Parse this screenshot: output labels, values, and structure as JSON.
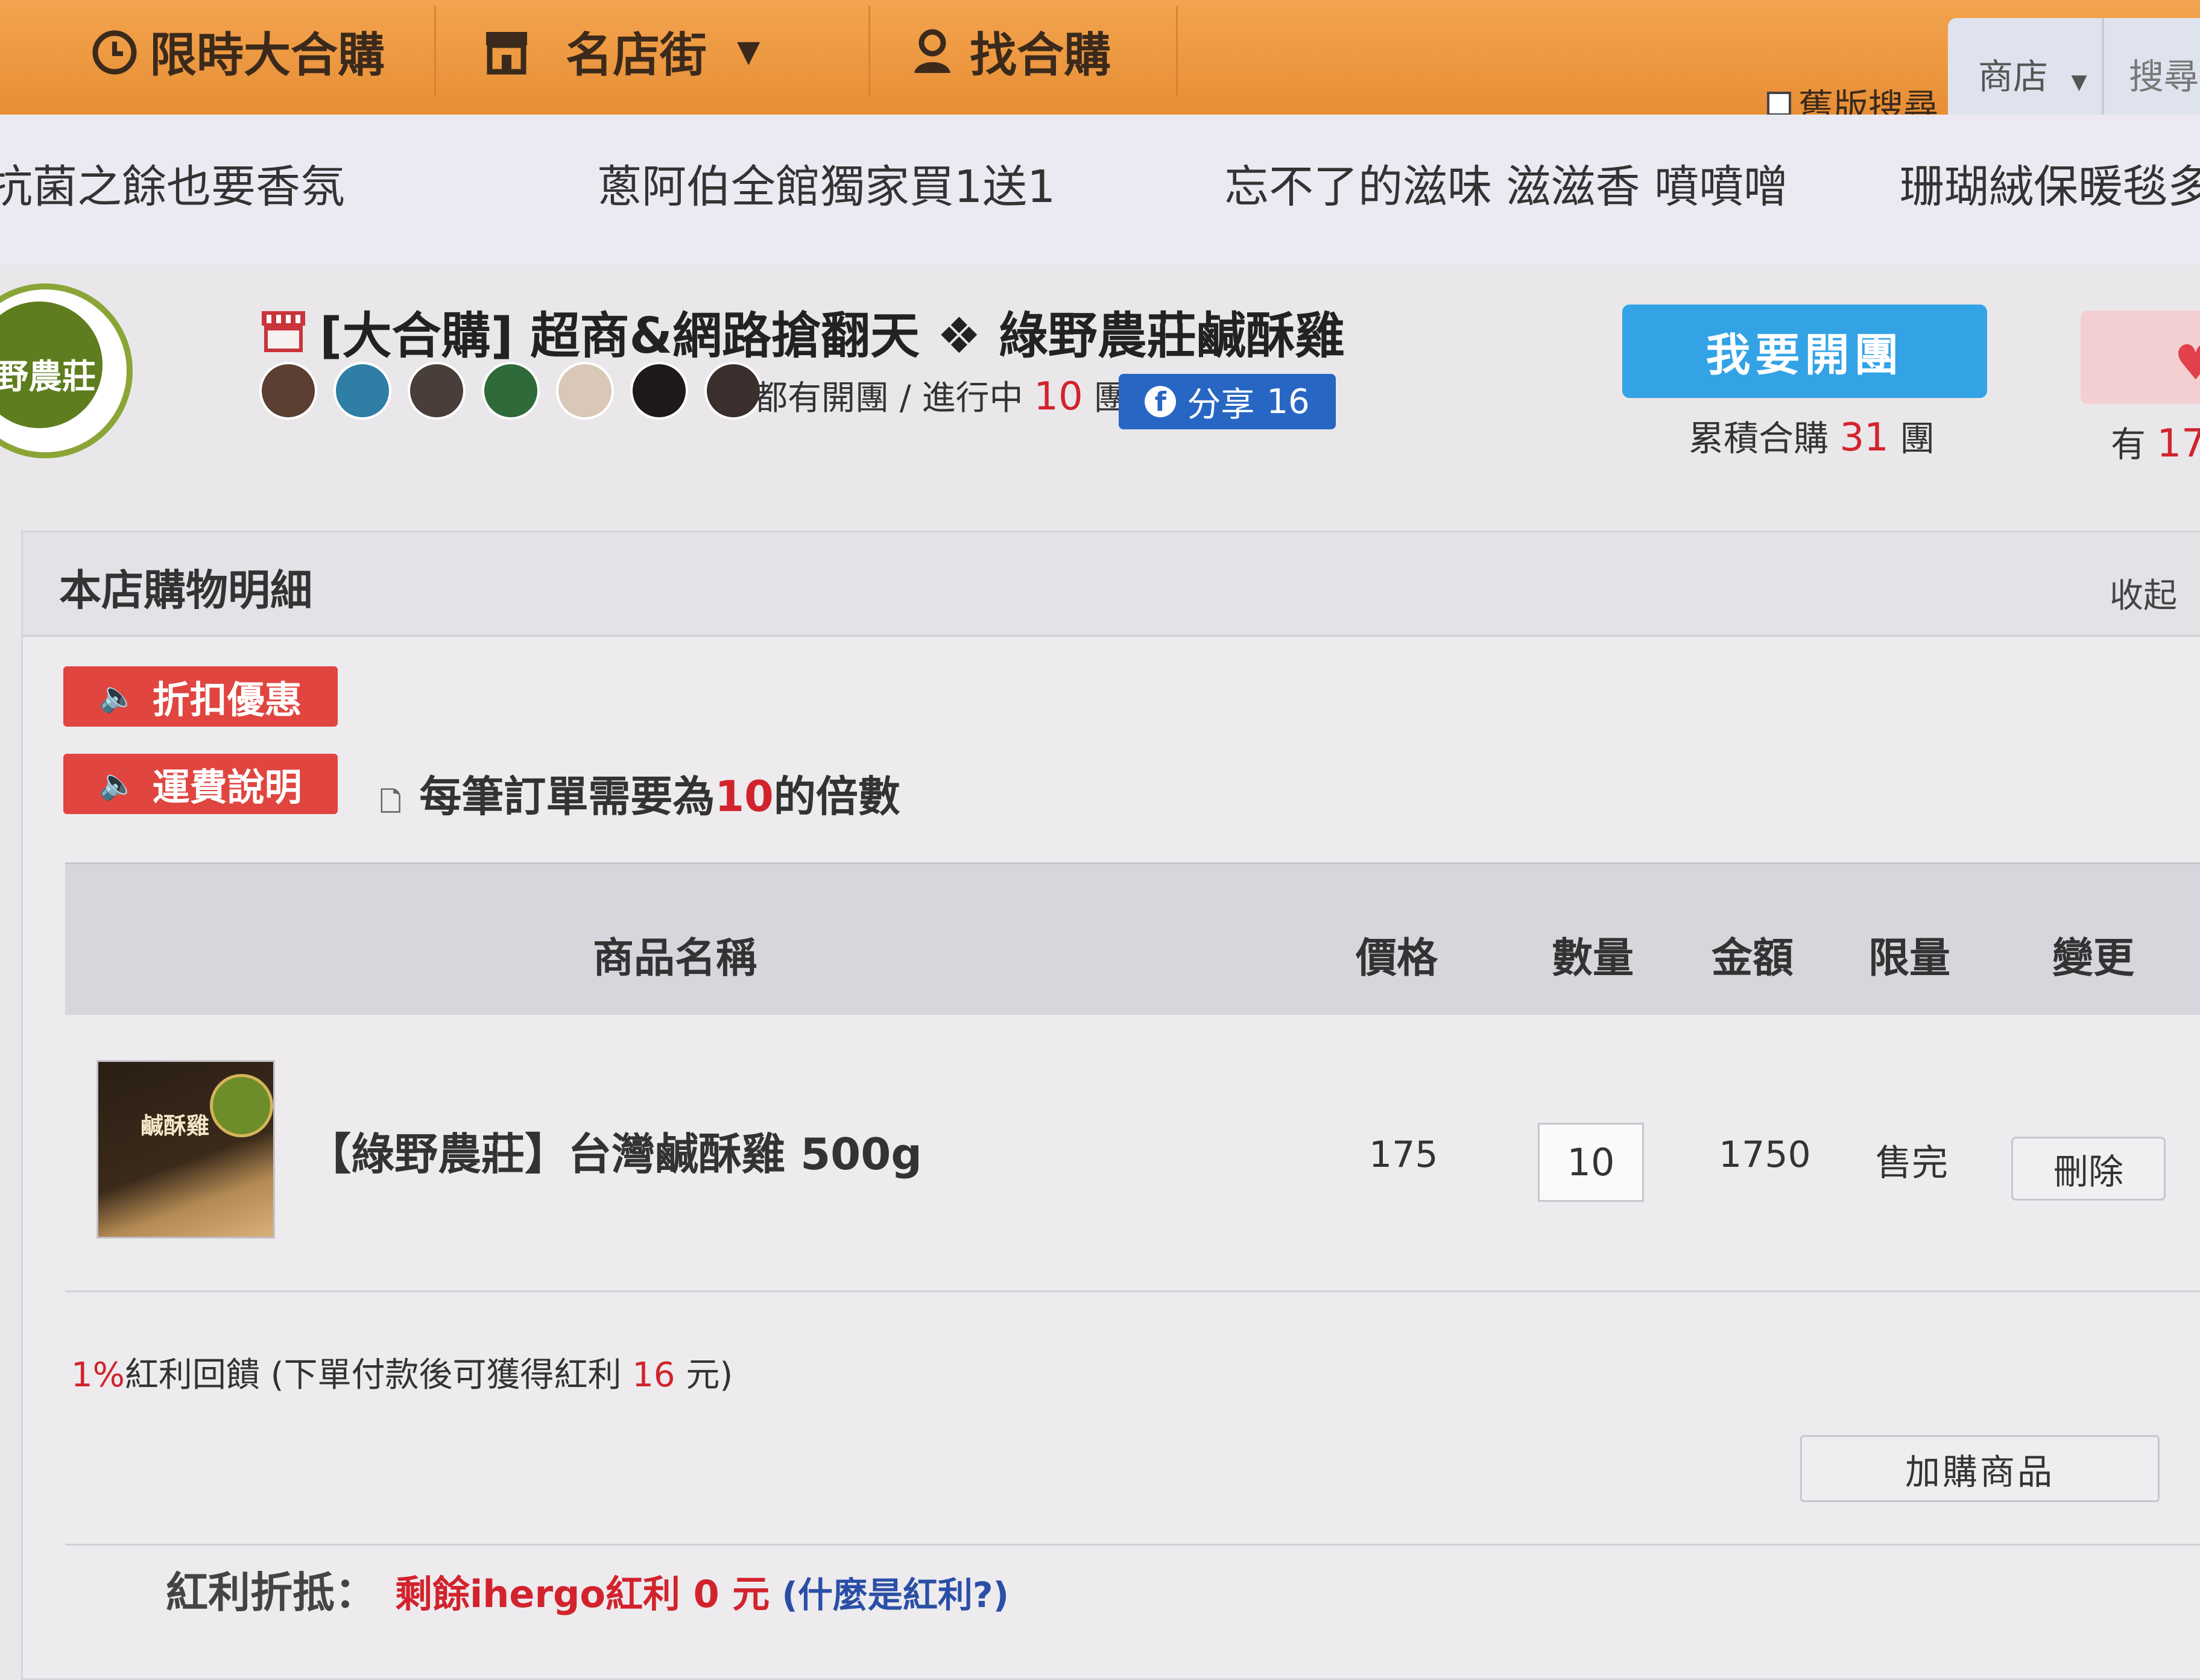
{
  "nav": {
    "flash_sale": "限時大合購",
    "famous_shops": "名店街",
    "find_group": "找合購",
    "old_search": "舊版搜尋",
    "search_scope": "商店",
    "search_placeholder": "搜尋"
  },
  "marquee": [
    "抗菌之餘也要香氛",
    "蔥阿伯全館獨家買1送1",
    "忘不了的滋味 滋滋香 噴噴噌",
    "珊瑚絨保暖毯多一"
  ],
  "shop": {
    "logo_text": "野農莊",
    "title": "[大合購] 超商&網路搶翻天 ❖ 綠野農莊鹹酥雞",
    "status_prefix": "都有開團 / 進行中 ",
    "active_groups": "10",
    "status_suffix": " 團",
    "share_label": "分享",
    "share_count": "16",
    "open_group_label": "我要開團",
    "accum_prefix": "累積合購 ",
    "accum_count": "31",
    "accum_suffix": " 團",
    "right_prefix": "有 ",
    "right_count": "17"
  },
  "cart": {
    "title": "本店購物明細",
    "collapse": "收起",
    "discount_btn": "折扣優惠",
    "shipping_btn": "運費說明",
    "order_note_prefix": "每筆訂單需要為",
    "order_note_value": "10",
    "order_note_suffix": "的倍數",
    "columns": [
      "商品名稱",
      "價格",
      "數量",
      "金額",
      "限量",
      "變更"
    ],
    "item": {
      "image_label": "鹹酥雞",
      "name": "【綠野農莊】台灣鹹酥雞 500g",
      "price": "175",
      "quantity": "10",
      "amount": "1750",
      "limit": "售完",
      "delete": "刪除"
    },
    "bonus_note": {
      "percent": "1%",
      "prefix": "紅利回饋 (下單付款後可獲得紅利 ",
      "value": "16",
      "suffix": " 元)"
    },
    "add_product": "加購商品",
    "bonus_deduct_label": "紅利折抵：",
    "bonus_remaining": "剩餘ihergo紅利 0 元",
    "bonus_help": "(什麼是紅利?)"
  },
  "colors": {
    "nav_orange": "#e78e35",
    "accent_red": "#d2232d",
    "button_red": "#e0453f",
    "share_blue": "#2866c4",
    "open_group_blue": "#33a3e6"
  }
}
